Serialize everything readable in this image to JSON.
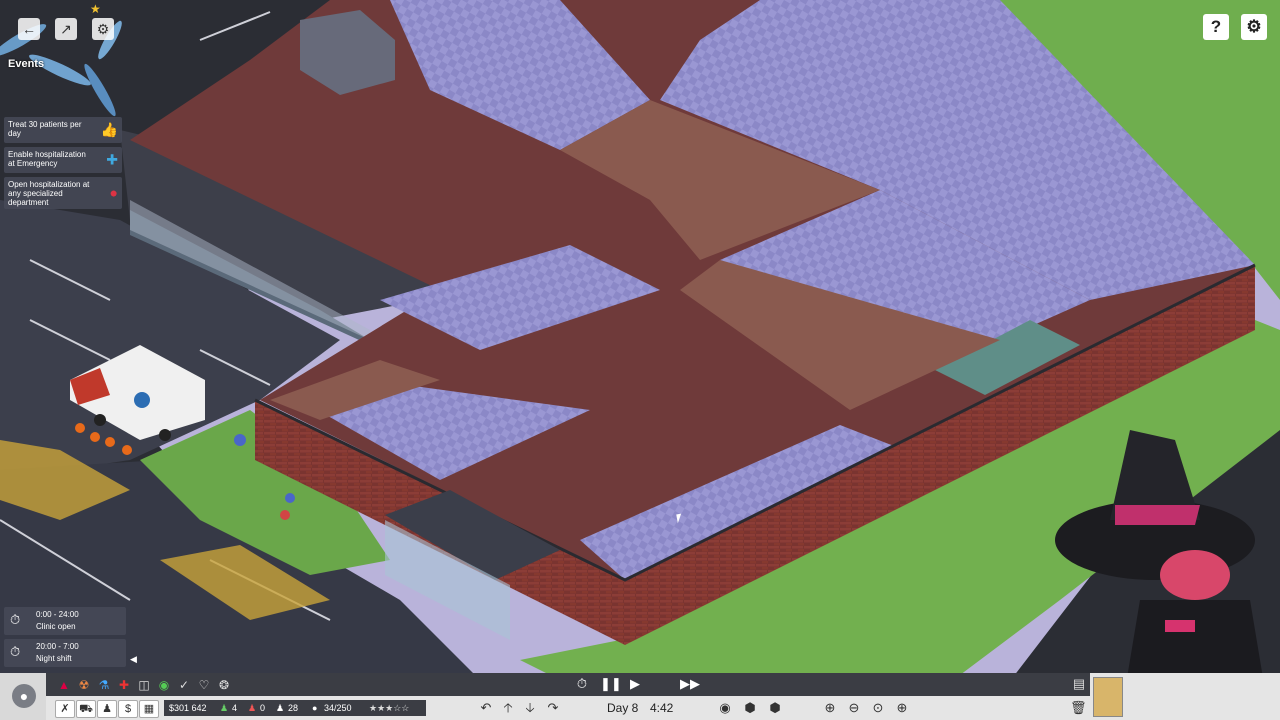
{
  "top_left": {
    "events_label": "Events",
    "events": [
      {
        "text": "Treat 30 patients per day",
        "icon": "thumbs-up-icon"
      },
      {
        "text": "Enable hospitalization at Emergency",
        "icon": "medical-cross-icon"
      },
      {
        "text": "Open hospitalization at any specialized department",
        "icon": "pills-icon"
      }
    ]
  },
  "top_right": {
    "help_label": "?",
    "settings_icon": "gear-icon"
  },
  "shifts": [
    {
      "time": "0:00 - 24:00",
      "label": "Clinic open"
    },
    {
      "time": "20:00 - 7:00",
      "label": "Night shift"
    }
  ],
  "stats": {
    "money": "$301 642",
    "staff_count": "4",
    "warning_count": "0",
    "patients_count": "28",
    "capacity": "34/250",
    "rating": "★★★☆☆"
  },
  "time_controls": {
    "day": "Day 8",
    "time": "4:42"
  },
  "colors": {
    "bar_dark": "#3b3d44",
    "bar_light": "#e5e5e5",
    "accent_red": "#c0392b"
  }
}
